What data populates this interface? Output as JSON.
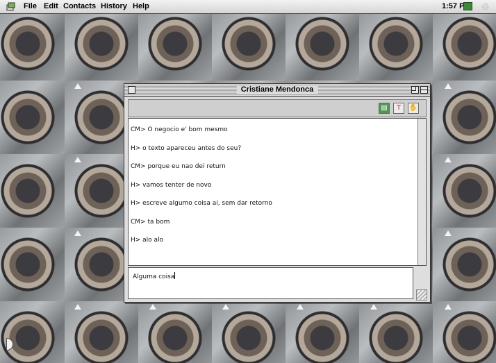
{
  "menubar": {
    "apple_icon": "apple-menu-icon",
    "items": [
      "File",
      "Edit",
      "Contacts",
      "History",
      "Help"
    ],
    "clock": "1:57 PM",
    "app_icon": "application-icon",
    "switcher_icon": "app-switcher-icon"
  },
  "window": {
    "title": "Cristiane Mendonca",
    "toolbar_icons": [
      "address-card-icon",
      "pin-icon",
      "hand-icon"
    ],
    "messages": [
      "CM> O negocio e' bom mesmo",
      "H> o texto apareceu antes do seu?",
      "CM> porque eu nao dei return",
      "H> vamos tenter de novo",
      "H> escreve algumo coisa ai, sem dar retorno",
      "CM> ta bom",
      "H> alo alo"
    ],
    "input_value": "Alguma coisa"
  },
  "colors": {
    "menubar": "#dedede",
    "window_bg": "#dedede",
    "accent_green": "#3a8a3a"
  }
}
